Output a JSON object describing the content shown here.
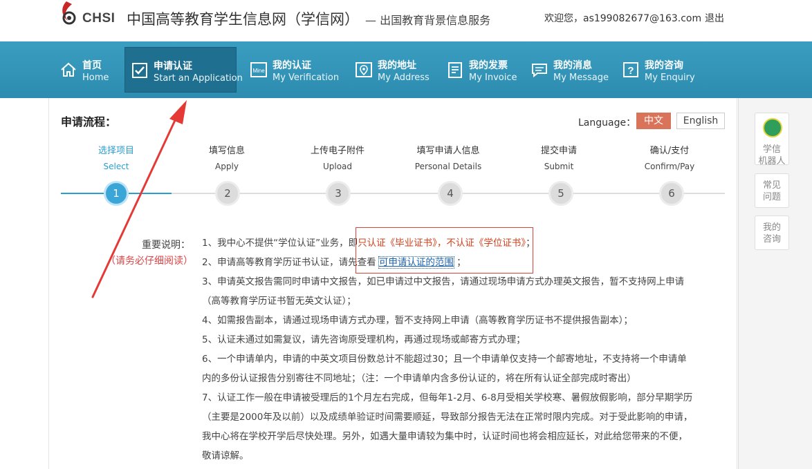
{
  "header": {
    "logo_text": "CHSI",
    "title": "中国高等教育学生信息网（学信网）",
    "subtitle": "— 出国教育背景信息服务",
    "welcome": "欢迎您，as199082677@163.com",
    "logout": "退出"
  },
  "nav": {
    "items": [
      {
        "cn": "首页",
        "en": "Home",
        "icon": "home-icon"
      },
      {
        "cn": "申请认证",
        "en": "Start an Application",
        "icon": "checkbox-icon"
      },
      {
        "cn": "我的认证",
        "en": "My Verification",
        "icon": "mine-icon"
      },
      {
        "cn": "我的地址",
        "en": "My Address",
        "icon": "location-icon"
      },
      {
        "cn": "我的发票",
        "en": "My Invoice",
        "icon": "invoice-icon"
      },
      {
        "cn": "我的消息",
        "en": "My Message",
        "icon": "message-icon"
      },
      {
        "cn": "我的咨询",
        "en": "My Enquiry",
        "icon": "question-icon"
      }
    ]
  },
  "process": {
    "title": "申请流程：",
    "language_label": "Language：",
    "lang_cn": "中文",
    "lang_en": "English",
    "steps": [
      {
        "cn": "选择项目",
        "en": "Select",
        "num": "1"
      },
      {
        "cn": "填写信息",
        "en": "Apply",
        "num": "2"
      },
      {
        "cn": "上传电子附件",
        "en": "Upload",
        "num": "3"
      },
      {
        "cn": "填写申请人信息",
        "en": "Personal Details",
        "num": "4"
      },
      {
        "cn": "提交申请",
        "en": "Submit",
        "num": "5"
      },
      {
        "cn": "确认/支付",
        "en": "Confirm/Pay",
        "num": "6"
      }
    ]
  },
  "notes": {
    "label": "重要说明：",
    "warning": "（请务必仔细阅读）",
    "n1_a": "1、我中心不提供“学位认证”业务，即",
    "n1_b": "只认证《毕业证书》，不认证《学位证书》",
    "n1_c": "；",
    "n2_a": "2、申请高等教育学历证书认证，请先查看 ",
    "n2_link": "可申请认证的范围",
    "n2_c": " ；",
    "n3_a": "3、申请英文报告需同时申请中文报告，如已申请过中文报告，请通过现场申请方式办理英文报告，暂不支持网上申请",
    "n3_b": "（高等教育学历证书暂无英文认证）；",
    "n4": "4、如需报告副本，请通过现场申请方式办理，暂不支持网上申请（高等教育学历证书不提供报告副本）；",
    "n5": "5、认证未通过如需复议，请先咨询原受理机构，再通过现场或邮寄方式办理；",
    "n6_a": "6、一个申请单内，申请的中英文项目份数总计不能超过30；且一个申请单仅支持一个邮寄地址，不支持将一个申请单",
    "n6_b": "内的多份认证报告分别寄往不同地址；（注：一个申请单内含多份认证的，将在所有认证全部完成时寄出）",
    "n7_a": "7、认证工作一般在申请被受理后的1个月左右完成，但每年1-2月、6-8月受相关学校寒、暑假放假影响，部分早期学历",
    "n7_b": "（主要是2000年及以前）以及成绩单验证时间需要顺延，导致部分报告无法在正常时限内完成。对于受此影响的申请，",
    "n7_c": "我中心将在学校开学后尽快处理。另外，如遇大量申请较为集中时，认证时间也将会相应延长，对此给您带来的不便，",
    "n7_d": "敬请谅解。"
  },
  "sidebar": {
    "robot_a": "学信",
    "robot_b": "机器人",
    "faq_a": "常见",
    "faq_b": "问题",
    "ask_a": "我的",
    "ask_b": "咨询"
  },
  "colors": {
    "nav_bg": "#3a9ec1",
    "nav_active": "#1f6f90",
    "accent_blue": "#2a9ed1",
    "lang_active": "#d9735a",
    "annotation_red": "#e53935"
  }
}
